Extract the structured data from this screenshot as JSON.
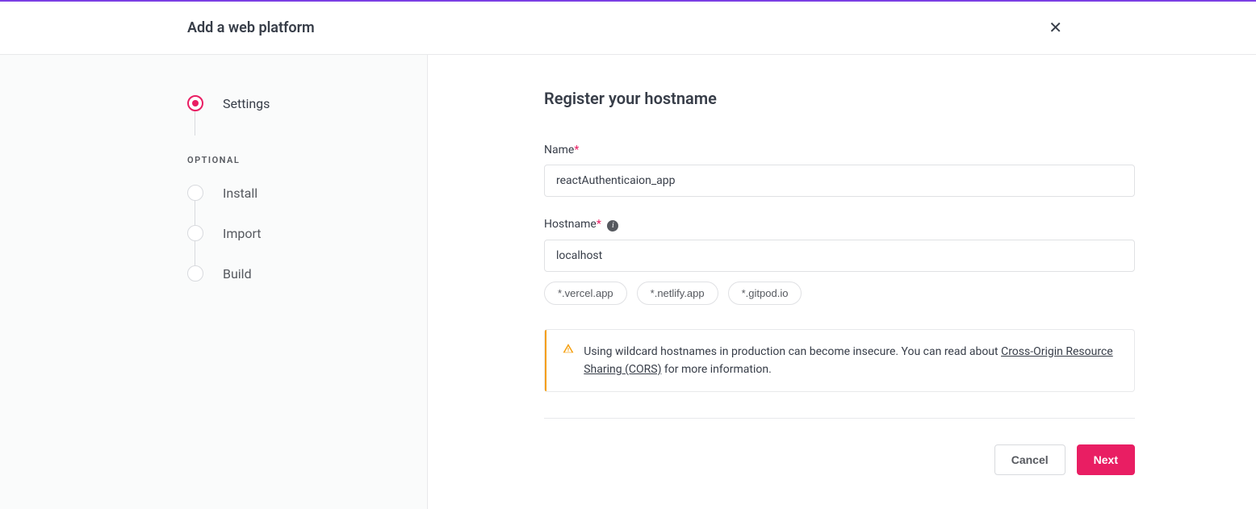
{
  "header": {
    "title": "Add a web platform"
  },
  "sidebar": {
    "steps": [
      {
        "label": "Settings",
        "active": true
      }
    ],
    "optional_label": "OPTIONAL",
    "optional_steps": [
      {
        "label": "Install"
      },
      {
        "label": "Import"
      },
      {
        "label": "Build"
      }
    ]
  },
  "main": {
    "title": "Register your hostname",
    "name_label": "Name",
    "name_value": "reactAuthenticaion_app",
    "hostname_label": "Hostname",
    "hostname_value": "localhost",
    "hostname_chips": [
      "*.vercel.app",
      "*.netlify.app",
      "*.gitpod.io"
    ],
    "alert_pre": "Using wildcard hostnames in production can become insecure. You can read about ",
    "alert_link": "Cross-Origin Resource Sharing (CORS)",
    "alert_post": " for more information."
  },
  "actions": {
    "cancel": "Cancel",
    "next": "Next"
  }
}
